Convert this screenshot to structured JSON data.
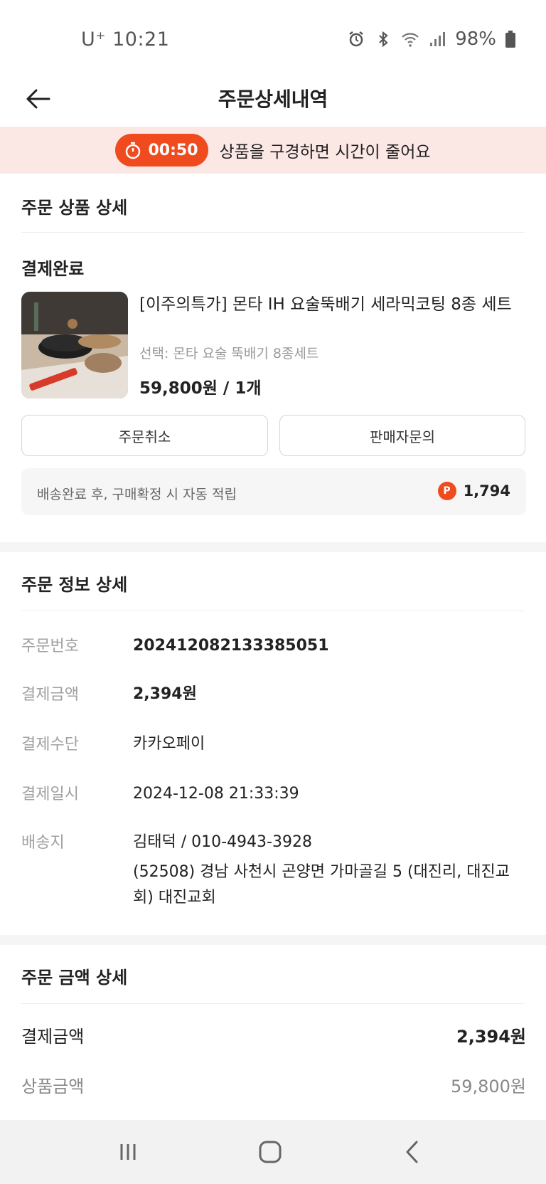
{
  "status_bar": {
    "carrier_time": "U⁺ 10:21",
    "battery": "98%",
    "icons": [
      "alarm-icon",
      "bluetooth-icon",
      "wifi-icon",
      "signal-icon",
      "battery-icon"
    ]
  },
  "header": {
    "title": "주문상세내역",
    "back_icon": "arrow-left-icon"
  },
  "timer_banner": {
    "time": "00:50",
    "message": "상품을 구경하면 시간이 줄어요",
    "accent": "#f04b1f",
    "background": "#fbe7e3"
  },
  "order_product": {
    "section_title": "주문 상품 상세",
    "status": "결제완료",
    "product_name": "[이주의특가] 몬타 IH 요술뚝배기 세라믹코팅 8종 세트",
    "option": "선택: 몬타 요술 뚝배기 8종세트",
    "price_qty": "59,800원 / 1개",
    "cancel_label": "주문취소",
    "inquiry_label": "판매자문의",
    "point_notice": "배송완료 후, 구매확정 시 자동 적립",
    "point_badge": "P",
    "point_value": "1,794"
  },
  "order_info": {
    "section_title": "주문 정보 상세",
    "rows": [
      {
        "label": "주문번호",
        "value": "20241208213338505​1"
      },
      {
        "label": "결제금액",
        "value": "2,394원"
      },
      {
        "label": "결제수단",
        "value": "카카오페이"
      },
      {
        "label": "결제일시",
        "value": "2024-12-08 21:33:39"
      },
      {
        "label": "배송지",
        "value": "김태덕 / 010-4943-3928",
        "address": "(52508) 경남 사천시 곤양면 가마골길 5 (대진리, 대진교회) 대진교회"
      }
    ]
  },
  "order_amount": {
    "section_title": "주문 금액 상세",
    "rows": [
      {
        "label": "결제금액",
        "value": "2,394원"
      },
      {
        "label": "상품금액",
        "value": "59,800원"
      }
    ]
  },
  "nav_bar": {
    "icons": [
      "recent-apps-icon",
      "home-icon",
      "back-icon"
    ]
  }
}
